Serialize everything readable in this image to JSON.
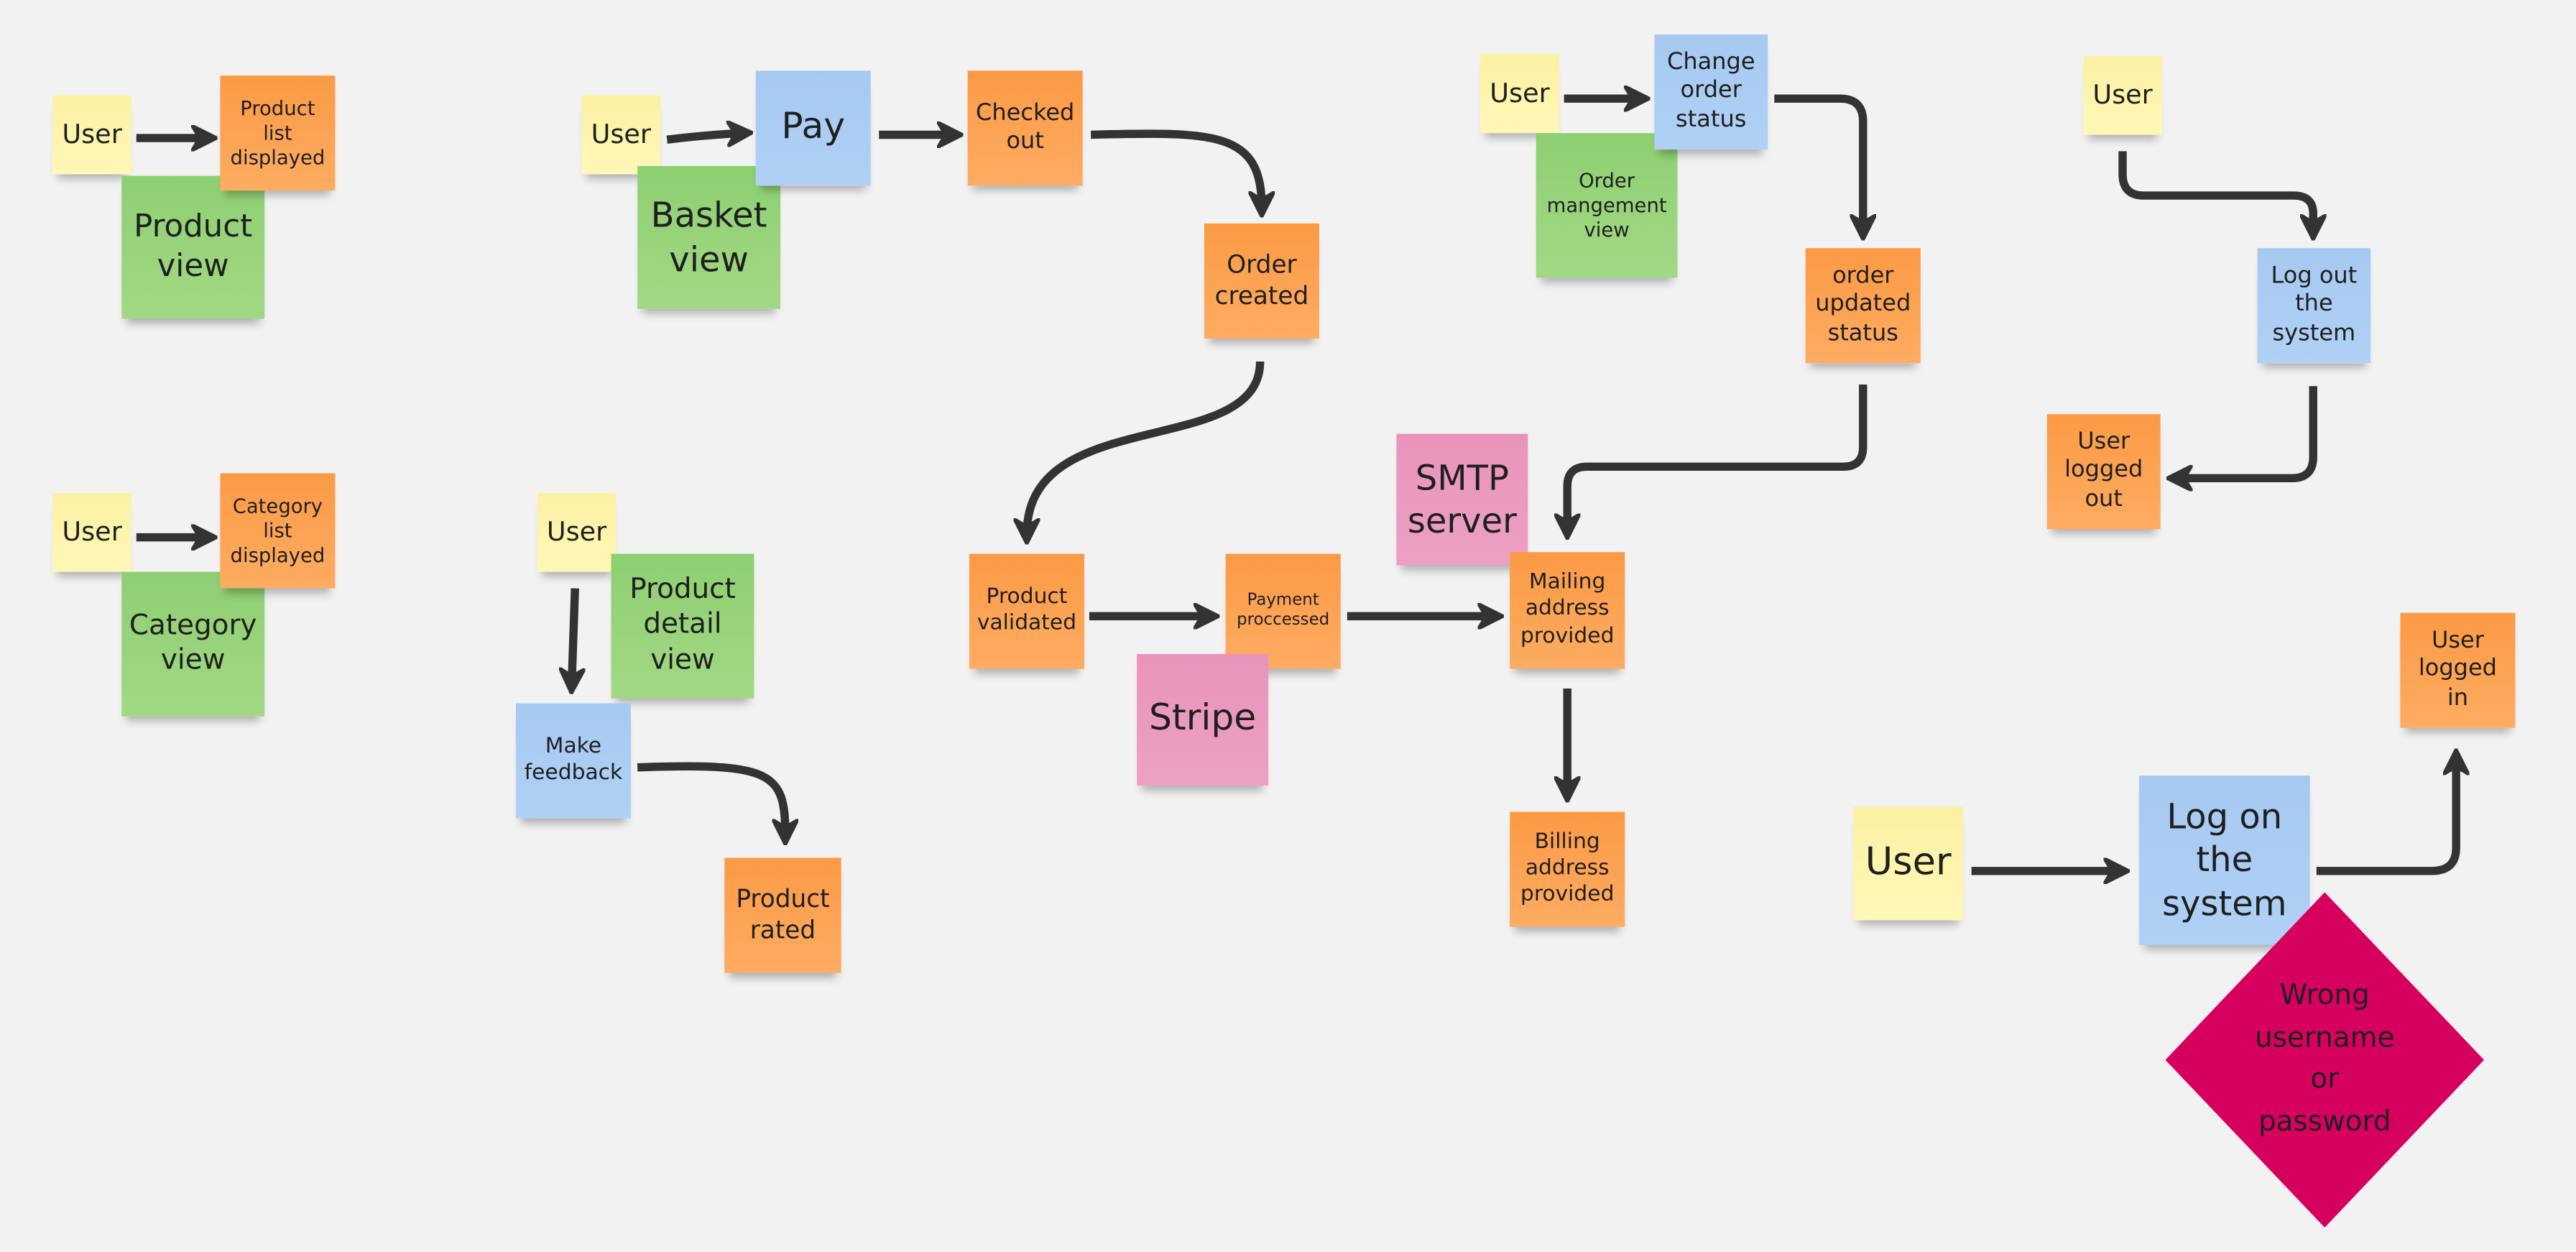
{
  "board": {
    "notes": {
      "user1": "User",
      "product_list_displayed": "Product\nlist\ndisplayed",
      "product_view": "Product\nview",
      "user2": "User",
      "category_list_displayed": "Category\nlist\ndisplayed",
      "category_view": "Category\nview",
      "user3": "User",
      "pay": "Pay",
      "basket_view": "Basket\nview",
      "checked_out": "Checked\nout",
      "order_created": "Order\ncreated",
      "user4": "User",
      "product_detail_view": "Product\ndetail\nview",
      "make_feedback": "Make\nfeedback",
      "product_rated": "Product\nrated",
      "product_validated": "Product\nvalidated",
      "payment_processed": "Payment\nproccessed",
      "stripe": "Stripe",
      "smtp_server": "SMTP\nserver",
      "mailing_address_provided": "Mailing\naddress\nprovided",
      "billing_address_provided": "Billing\naddress\nprovided",
      "user5": "User",
      "change_order_status": "Change\norder\nstatus",
      "order_management_view": "Order\nmangement\nview",
      "order_updated_status": "order\nupdated\nstatus",
      "user6": "User",
      "log_out_system": "Log out\nthe\nsystem",
      "user_logged_out": "User\nlogged\nout",
      "user7": "User",
      "log_on_system": "Log on\nthe\nsystem",
      "user_logged_in": "User\nlogged\nin",
      "wrong_credentials": "Wrong\nusername\nor\npassword"
    },
    "colors": {
      "event": "#fc9a45",
      "actor": "#fff7b6",
      "view": "#8ecf72",
      "command": "#a6c9f1",
      "external_system": "#e993bb",
      "hotspot": "#d6005e",
      "arrow": "#333333"
    }
  }
}
